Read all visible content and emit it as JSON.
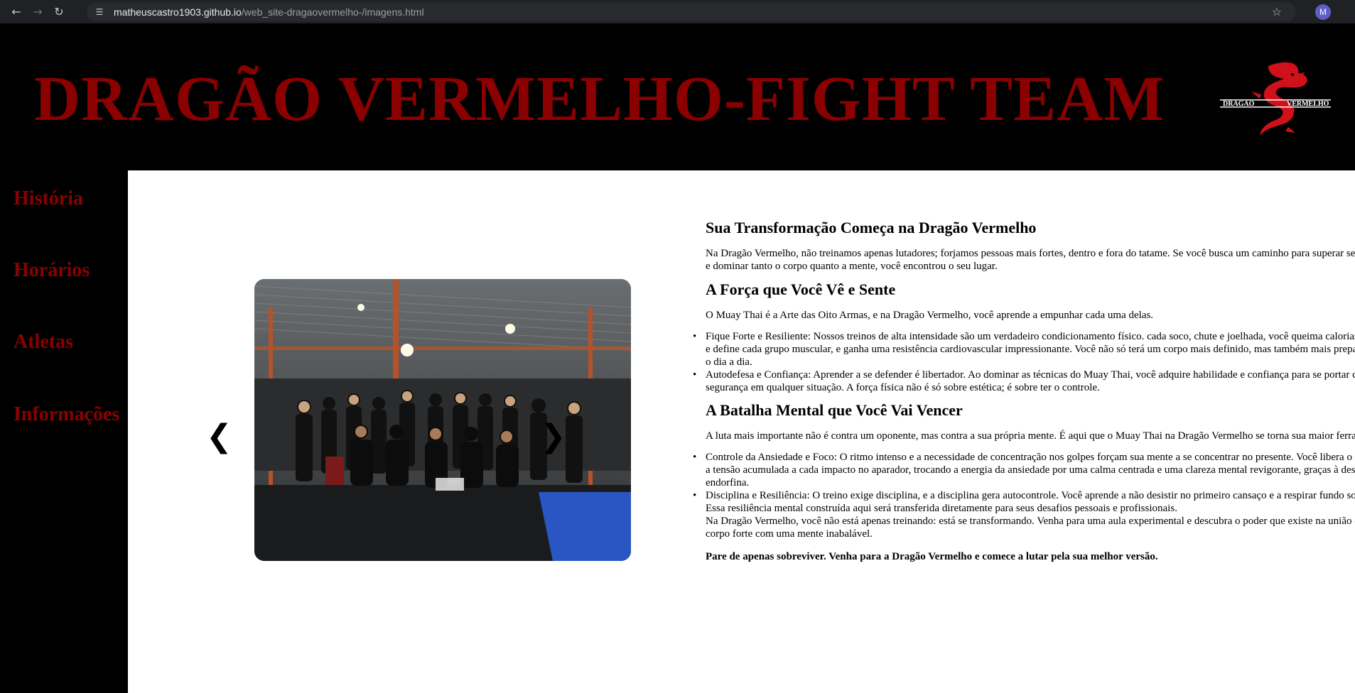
{
  "browser": {
    "url_host": "matheuscastro1903.github.io",
    "url_path": "/web_site-dragaovermelho-/imagens.html",
    "profile_initial": "M"
  },
  "header": {
    "title": "DRAGÃO VERMELHO-FIGHT TEAM",
    "logo_left_text": "DRAGÃO",
    "logo_right_text": "VERMELHO"
  },
  "colors": {
    "brand_red": "#8b0000",
    "background": "#000000",
    "content_bg": "#ffffff"
  },
  "sidebar": {
    "items": [
      {
        "label": "História"
      },
      {
        "label": "Horários"
      },
      {
        "label": "Atletas"
      },
      {
        "label": "Informações"
      }
    ]
  },
  "carousel": {
    "prev_label": "❮",
    "next_label": "❯"
  },
  "content": {
    "h1": "Sua Transformação Começa na Dragão Vermelho",
    "p1": "Na Dragão Vermelho, não treinamos apenas lutadores; forjamos pessoas mais fortes, dentro e fora do tatame. Se você busca um caminho para superar seus limites e dominar tanto o corpo quanto a mente, você encontrou o seu lugar.",
    "h2": "A Força que Você Vê e Sente",
    "p2": "O Muay Thai é a Arte das Oito Armas, e na Dragão Vermelho, você aprende a empunhar cada uma delas.",
    "list1": [
      "Fique Forte e Resiliente: Nossos treinos de alta intensidade são um verdadeiro condicionamento físico. cada soco, chute e joelhada, você queima calorias, fortalece e define cada grupo muscular, e ganha uma resistência cardiovascular impressionante. Você não só terá um corpo mais definido, mas também mais preparado para o dia a dia.",
      "Autodefesa e Confiança: Aprender a se defender é libertador. Ao dominar as técnicas do Muay Thai, você adquire habilidade e confiança para se portar com segurança em qualquer situação. A força física não é só sobre estética; é sobre ter o controle."
    ],
    "h3": "A Batalha Mental que Você Vai Vencer",
    "p3": "A luta mais importante não é contra um oponente, mas contra a sua própria mente. É aqui que o Muay Thai na Dragão Vermelho se torna sua maior ferramenta.",
    "list2": [
      "Controle da Ansiedade e Foco: O ritmo intenso e a necessidade de concentração nos golpes forçam sua mente a se concentrar no presente. Você libera o estresse e a tensão acumulada a cada impacto no aparador, trocando a energia da ansiedade por uma calma centrada e uma clareza mental revigorante, graças à descarga de endorfina.",
      "Disciplina e Resiliência: O treino exige disciplina, e a disciplina gera autocontrole. Você aprende a não desistir no primeiro cansaço e a respirar fundo sob pressão. Essa resiliência mental construída aqui será transferida diretamente para seus desafios pessoais e profissionais."
    ],
    "p4": "Na Dragão Vermelho, você não está apenas treinando: está se transformando. Venha para uma aula experimental e descubra o poder que existe na união de um corpo forte com uma mente inabalável.",
    "p5": "Pare de apenas sobreviver. Venha para a Dragão Vermelho e comece a lutar pela sua melhor versão."
  }
}
